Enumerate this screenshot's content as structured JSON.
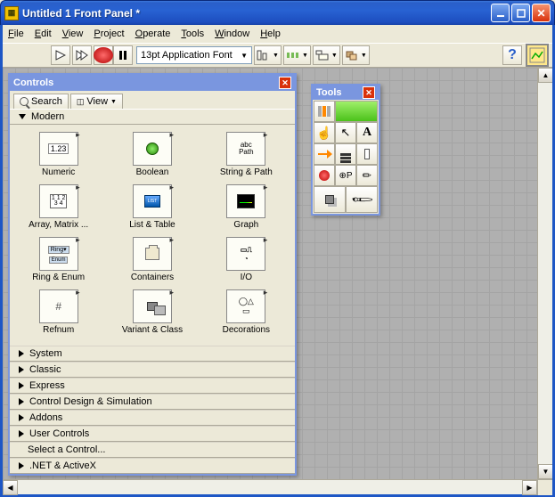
{
  "window": {
    "title": "Untitled 1 Front Panel *"
  },
  "menu": {
    "file": "File",
    "edit": "Edit",
    "view": "View",
    "project": "Project",
    "operate": "Operate",
    "tools": "Tools",
    "window": "Window",
    "help": "Help"
  },
  "toolbar": {
    "font": "13pt Application Font",
    "help": "?"
  },
  "controls_palette": {
    "title": "Controls",
    "search": "Search",
    "view": "View",
    "categories": {
      "modern": "Modern",
      "system": "System",
      "classic": "Classic",
      "express": "Express",
      "cds": "Control Design & Simulation",
      "addons": "Addons",
      "user": "User Controls",
      "select": "Select a Control...",
      "dotnet": ".NET & ActiveX"
    },
    "modern_items": {
      "numeric": "Numeric",
      "boolean": "Boolean",
      "string": "String & Path",
      "array": "Array, Matrix ...",
      "list": "List & Table",
      "graph": "Graph",
      "ring": "Ring & Enum",
      "containers": "Containers",
      "io": "I/O",
      "refnum": "Refnum",
      "variant": "Variant & Class",
      "decorations": "Decorations"
    }
  },
  "tools_palette": {
    "title": "Tools"
  }
}
